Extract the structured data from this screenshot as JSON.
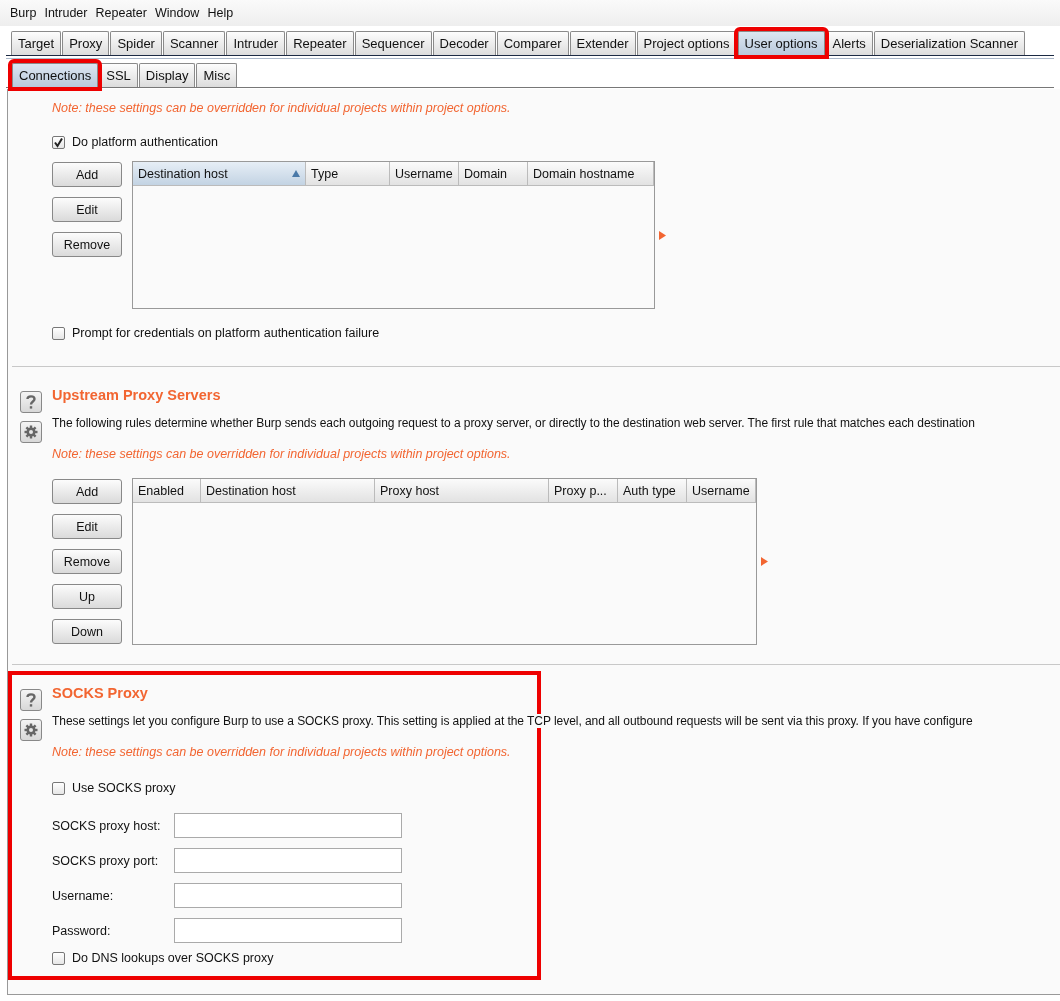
{
  "menu": [
    "Burp",
    "Intruder",
    "Repeater",
    "Window",
    "Help"
  ],
  "tabs": [
    {
      "label": "Target",
      "selected": false,
      "highlighted": false
    },
    {
      "label": "Proxy",
      "selected": false,
      "highlighted": false
    },
    {
      "label": "Spider",
      "selected": false,
      "highlighted": false
    },
    {
      "label": "Scanner",
      "selected": false,
      "highlighted": false
    },
    {
      "label": "Intruder",
      "selected": false,
      "highlighted": false
    },
    {
      "label": "Repeater",
      "selected": false,
      "highlighted": false
    },
    {
      "label": "Sequencer",
      "selected": false,
      "highlighted": false
    },
    {
      "label": "Decoder",
      "selected": false,
      "highlighted": false
    },
    {
      "label": "Comparer",
      "selected": false,
      "highlighted": false
    },
    {
      "label": "Extender",
      "selected": false,
      "highlighted": false
    },
    {
      "label": "Project options",
      "selected": false,
      "highlighted": false
    },
    {
      "label": "User options",
      "selected": true,
      "highlighted": true
    },
    {
      "label": "Alerts",
      "selected": false,
      "highlighted": false
    },
    {
      "label": "Deserialization Scanner",
      "selected": false,
      "highlighted": false
    }
  ],
  "subtabs": [
    {
      "label": "Connections",
      "selected": true,
      "highlighted": true
    },
    {
      "label": "SSL",
      "selected": false,
      "highlighted": false
    },
    {
      "label": "Display",
      "selected": false,
      "highlighted": false
    },
    {
      "label": "Misc",
      "selected": false,
      "highlighted": false
    }
  ],
  "platform_auth": {
    "note": "Note: these settings can be overridden for individual projects within project options.",
    "enable": {
      "label": "Do platform authentication",
      "checked": true
    },
    "buttons": [
      "Add",
      "Edit",
      "Remove"
    ],
    "table": {
      "columns": [
        {
          "label": "Destination host",
          "sorted": true
        },
        {
          "label": "Type",
          "sorted": false
        },
        {
          "label": "Username",
          "sorted": false
        },
        {
          "label": "Domain",
          "sorted": false
        },
        {
          "label": "Domain hostname",
          "sorted": false
        }
      ]
    },
    "prompt": {
      "label": "Prompt for credentials on platform authentication failure",
      "checked": false
    }
  },
  "upstream": {
    "title": "Upstream Proxy Servers",
    "description": "The following rules determine whether Burp sends each outgoing request to a proxy server, or directly to the destination web server. The first rule that matches each destination",
    "note": "Note: these settings can be overridden for individual projects within project options.",
    "buttons": [
      "Add",
      "Edit",
      "Remove",
      "Up",
      "Down"
    ],
    "table": {
      "columns": [
        {
          "label": "Enabled",
          "sorted": false
        },
        {
          "label": "Destination host",
          "sorted": false
        },
        {
          "label": "Proxy host",
          "sorted": false
        },
        {
          "label": "Proxy p...",
          "sorted": false
        },
        {
          "label": "Auth type",
          "sorted": false
        },
        {
          "label": "Username",
          "sorted": false
        }
      ]
    }
  },
  "socks": {
    "title": "SOCKS Proxy",
    "highlighted": true,
    "description": "These settings let you configure Burp to use a SOCKS proxy. This setting is applied at the TCP level, and all outbound requests will be sent via this proxy. If you have configure",
    "note": "Note: these settings can be overridden for individual projects within project options.",
    "use": {
      "label": "Use SOCKS proxy",
      "checked": false
    },
    "fields": [
      {
        "label": "SOCKS proxy host:"
      },
      {
        "label": "SOCKS proxy port:"
      },
      {
        "label": "Username:"
      },
      {
        "label": "Password:"
      }
    ],
    "dns": {
      "label": "Do DNS lookups over SOCKS proxy",
      "checked": false
    }
  }
}
